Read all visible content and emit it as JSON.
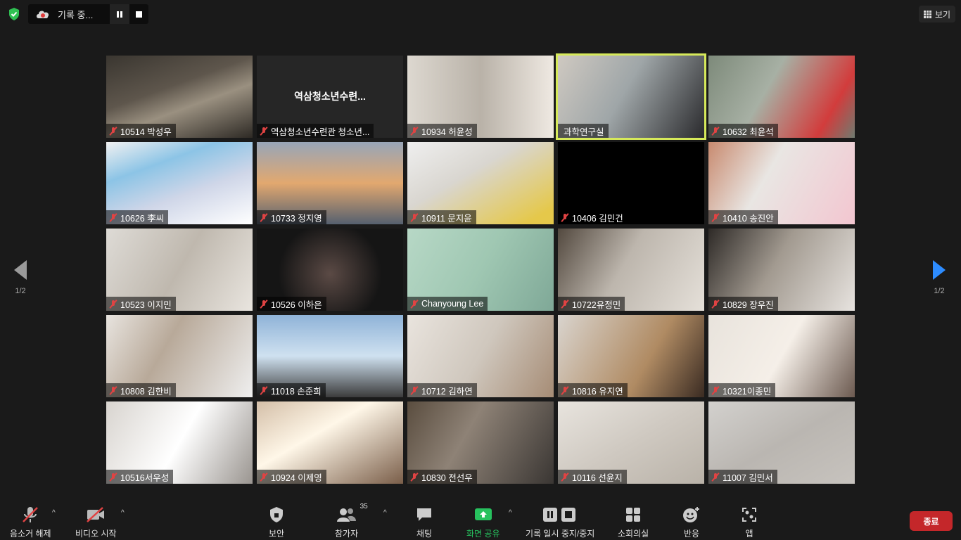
{
  "topbar": {
    "recording_label": "기록 중...",
    "view_label": "보기"
  },
  "pager": {
    "left": "1/2",
    "right": "1/2"
  },
  "tiles": [
    {
      "name": "10514 박성우"
    },
    {
      "name": "역삼청소년수련관 청소년...",
      "center": "역삼청소년수련..."
    },
    {
      "name": "10934 허윤성"
    },
    {
      "name": "과학연구실"
    },
    {
      "name": "10632 최윤석"
    },
    {
      "name": "10626 李씨"
    },
    {
      "name": "10733 정지영"
    },
    {
      "name": "10911 문지윤"
    },
    {
      "name": "10406 김민건"
    },
    {
      "name": "10410 송진안"
    },
    {
      "name": "10523 이지민"
    },
    {
      "name": "10526 이하은"
    },
    {
      "name": "Chanyoung Lee"
    },
    {
      "name": "10722유정민"
    },
    {
      "name": "10829 장우진"
    },
    {
      "name": "10808 김한비"
    },
    {
      "name": "11018 손준희"
    },
    {
      "name": "10712 김하연"
    },
    {
      "name": "10816 유지연"
    },
    {
      "name": "10321이종민"
    },
    {
      "name": "10516서우성"
    },
    {
      "name": "10924 이제영"
    },
    {
      "name": "10830 전선우"
    },
    {
      "name": "10116 선윤지"
    },
    {
      "name": "11007 김민서"
    }
  ],
  "toolbar": {
    "unmute": "음소거 해제",
    "start_video": "비디오 시작",
    "security": "보안",
    "participants": "참가자",
    "participants_count": "35",
    "chat": "채팅",
    "share": "화면 공유",
    "record": "기록 일시 중지/중지",
    "breakout": "소회의실",
    "reactions": "반응",
    "apps": "앱",
    "end": "종료"
  },
  "colors": {
    "active_speaker": "#d6e95a",
    "end_button": "#c4272a",
    "share_green": "#27c15e",
    "nav_blue": "#2d8cff"
  }
}
